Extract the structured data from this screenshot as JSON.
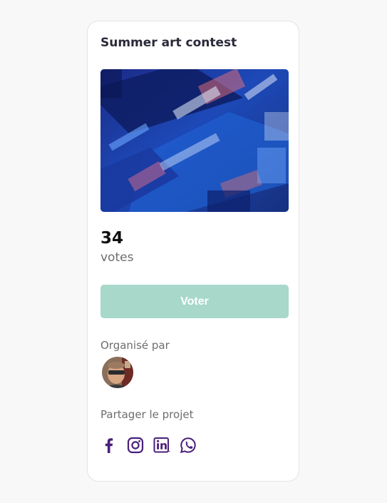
{
  "contest": {
    "title": "Summer art contest",
    "votes_count": "34",
    "votes_label": "votes",
    "vote_button_label": "Voter"
  },
  "organizer": {
    "label": "Organisé par"
  },
  "share": {
    "label": "Partager le projet",
    "icons": [
      "facebook-icon",
      "instagram-icon",
      "linkedin-icon",
      "whatsapp-icon"
    ]
  },
  "colors": {
    "accent_button": "#a7d8ca",
    "social_icon": "#4a1f7a",
    "page_background": "#f8f8f8",
    "card_background": "#ffffff"
  }
}
